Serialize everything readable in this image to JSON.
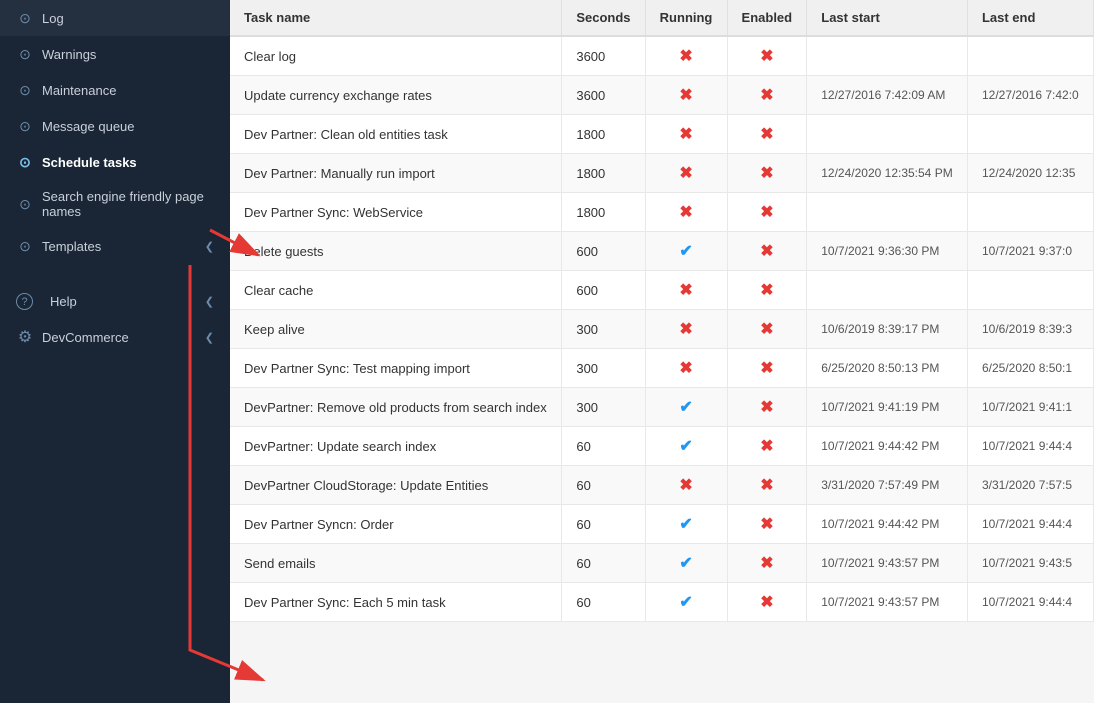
{
  "sidebar": {
    "items": [
      {
        "id": "log",
        "label": "Log",
        "icon": "⊙",
        "active": false
      },
      {
        "id": "warnings",
        "label": "Warnings",
        "icon": "⊙",
        "active": false
      },
      {
        "id": "maintenance",
        "label": "Maintenance",
        "icon": "⊙",
        "active": false
      },
      {
        "id": "message-queue",
        "label": "Message queue",
        "icon": "⊙",
        "active": false
      },
      {
        "id": "schedule-tasks",
        "label": "Schedule tasks",
        "icon": "⊙",
        "active": true
      },
      {
        "id": "sefpn",
        "label": "Search engine friendly page names",
        "icon": "⊙",
        "active": false
      },
      {
        "id": "templates",
        "label": "Templates",
        "icon": "⊙",
        "active": false,
        "hasChevron": true
      },
      {
        "id": "help",
        "label": "Help",
        "icon": "?",
        "active": false,
        "isHelp": true,
        "hasChevron": true
      },
      {
        "id": "devcommerce",
        "label": "DevCommerce",
        "icon": "⊗",
        "active": false,
        "hasChevron": true
      }
    ]
  },
  "table": {
    "columns": [
      "Task name",
      "Seconds",
      "Running",
      "Enabled",
      "Last start",
      "Last end"
    ],
    "rows": [
      {
        "name": "Clear log",
        "seconds": 3600,
        "running": false,
        "enabled": false,
        "lastStart": "",
        "lastEnd": ""
      },
      {
        "name": "Update currency exchange rates",
        "seconds": 3600,
        "running": false,
        "enabled": false,
        "lastStart": "12/27/2016 7:42:09 AM",
        "lastEnd": "12/27/2016 7:42:0"
      },
      {
        "name": "Dev Partner: Clean old entities task",
        "seconds": 1800,
        "running": false,
        "enabled": false,
        "lastStart": "",
        "lastEnd": ""
      },
      {
        "name": "Dev Partner: Manually run import",
        "seconds": 1800,
        "running": false,
        "enabled": false,
        "lastStart": "12/24/2020 12:35:54 PM",
        "lastEnd": "12/24/2020 12:35"
      },
      {
        "name": "Dev Partner Sync: WebService",
        "seconds": 1800,
        "running": false,
        "enabled": false,
        "lastStart": "",
        "lastEnd": ""
      },
      {
        "name": "Delete guests",
        "seconds": 600,
        "running": true,
        "enabled": false,
        "lastStart": "10/7/2021 9:36:30 PM",
        "lastEnd": "10/7/2021 9:37:0"
      },
      {
        "name": "Clear cache",
        "seconds": 600,
        "running": false,
        "enabled": false,
        "lastStart": "",
        "lastEnd": ""
      },
      {
        "name": "Keep alive",
        "seconds": 300,
        "running": false,
        "enabled": false,
        "lastStart": "10/6/2019 8:39:17 PM",
        "lastEnd": "10/6/2019 8:39:3"
      },
      {
        "name": "Dev Partner Sync: Test mapping import",
        "seconds": 300,
        "running": false,
        "enabled": false,
        "lastStart": "6/25/2020 8:50:13 PM",
        "lastEnd": "6/25/2020 8:50:1"
      },
      {
        "name": "DevPartner: Remove old products from search index",
        "seconds": 300,
        "running": true,
        "enabled": false,
        "lastStart": "10/7/2021 9:41:19 PM",
        "lastEnd": "10/7/2021 9:41:1"
      },
      {
        "name": "DevPartner: Update search index",
        "seconds": 60,
        "running": true,
        "enabled": false,
        "lastStart": "10/7/2021 9:44:42 PM",
        "lastEnd": "10/7/2021 9:44:4"
      },
      {
        "name": "DevPartner CloudStorage: Update Entities",
        "seconds": 60,
        "running": false,
        "enabled": false,
        "lastStart": "3/31/2020 7:57:49 PM",
        "lastEnd": "3/31/2020 7:57:5"
      },
      {
        "name": "Dev Partner Syncn: Order",
        "seconds": 60,
        "running": true,
        "enabled": false,
        "lastStart": "10/7/2021 9:44:42 PM",
        "lastEnd": "10/7/2021 9:44:4"
      },
      {
        "name": "Send emails",
        "seconds": 60,
        "running": true,
        "enabled": false,
        "lastStart": "10/7/2021 9:43:57 PM",
        "lastEnd": "10/7/2021 9:43:5"
      },
      {
        "name": "Dev Partner Sync: Each 5 min task",
        "seconds": 60,
        "running": true,
        "enabled": false,
        "lastStart": "10/7/2021 9:43:57 PM",
        "lastEnd": "10/7/2021 9:44:4"
      }
    ]
  }
}
